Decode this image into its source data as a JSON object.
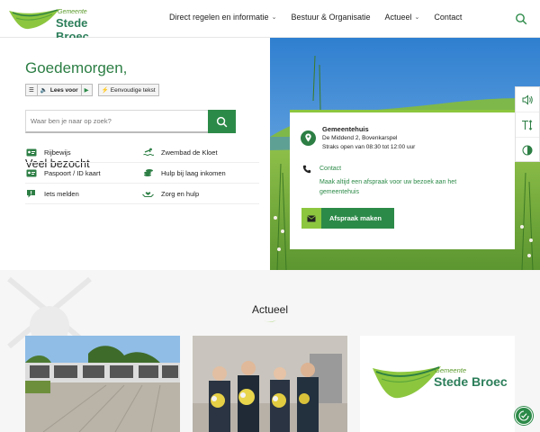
{
  "logo": {
    "line1": "Gemeente",
    "line2": "Stede Broec"
  },
  "nav": {
    "items": [
      {
        "label": "Direct regelen en informatie",
        "has_dropdown": true
      },
      {
        "label": "Bestuur & Organisatie",
        "has_dropdown": false
      },
      {
        "label": "Actueel",
        "has_dropdown": true
      },
      {
        "label": "Contact",
        "has_dropdown": false
      }
    ]
  },
  "hero": {
    "greeting": "Goedemorgen,",
    "toolbar": {
      "lees_voor": "Lees voor",
      "eenvoudige_tekst": "Eenvoudige tekst"
    },
    "search": {
      "placeholder": "Waar ben je naar op zoek?"
    }
  },
  "veel_bezocht": {
    "title": "Veel bezocht",
    "items": [
      {
        "label": "Rijbewijs",
        "icon": "id-card-icon"
      },
      {
        "label": "Zwembad de Kloet",
        "icon": "swimmer-icon"
      },
      {
        "label": "Paspoort / ID kaart",
        "icon": "id-card-icon"
      },
      {
        "label": "Hulp bij laag inkomen",
        "icon": "coins-icon"
      },
      {
        "label": "Iets melden",
        "icon": "exclamation-bubble-icon"
      },
      {
        "label": "Zorg en hulp",
        "icon": "hands-heart-icon"
      }
    ]
  },
  "gemeentehuis": {
    "title": "Gemeentehuis",
    "address": "De Middend 2, Bovenkarspel",
    "opening": "Straks open van 08:30 tot 12:00 uur",
    "contact_label": "Contact",
    "note": "Maak altijd een afspraak voor uw bezoek aan het gemeentehuis",
    "button_label": "Afspraak maken"
  },
  "actueel": {
    "title": "Actueel"
  },
  "colors": {
    "primary": "#2c8a48",
    "accent": "#8cc63f",
    "text_green": "#2c7e44"
  }
}
